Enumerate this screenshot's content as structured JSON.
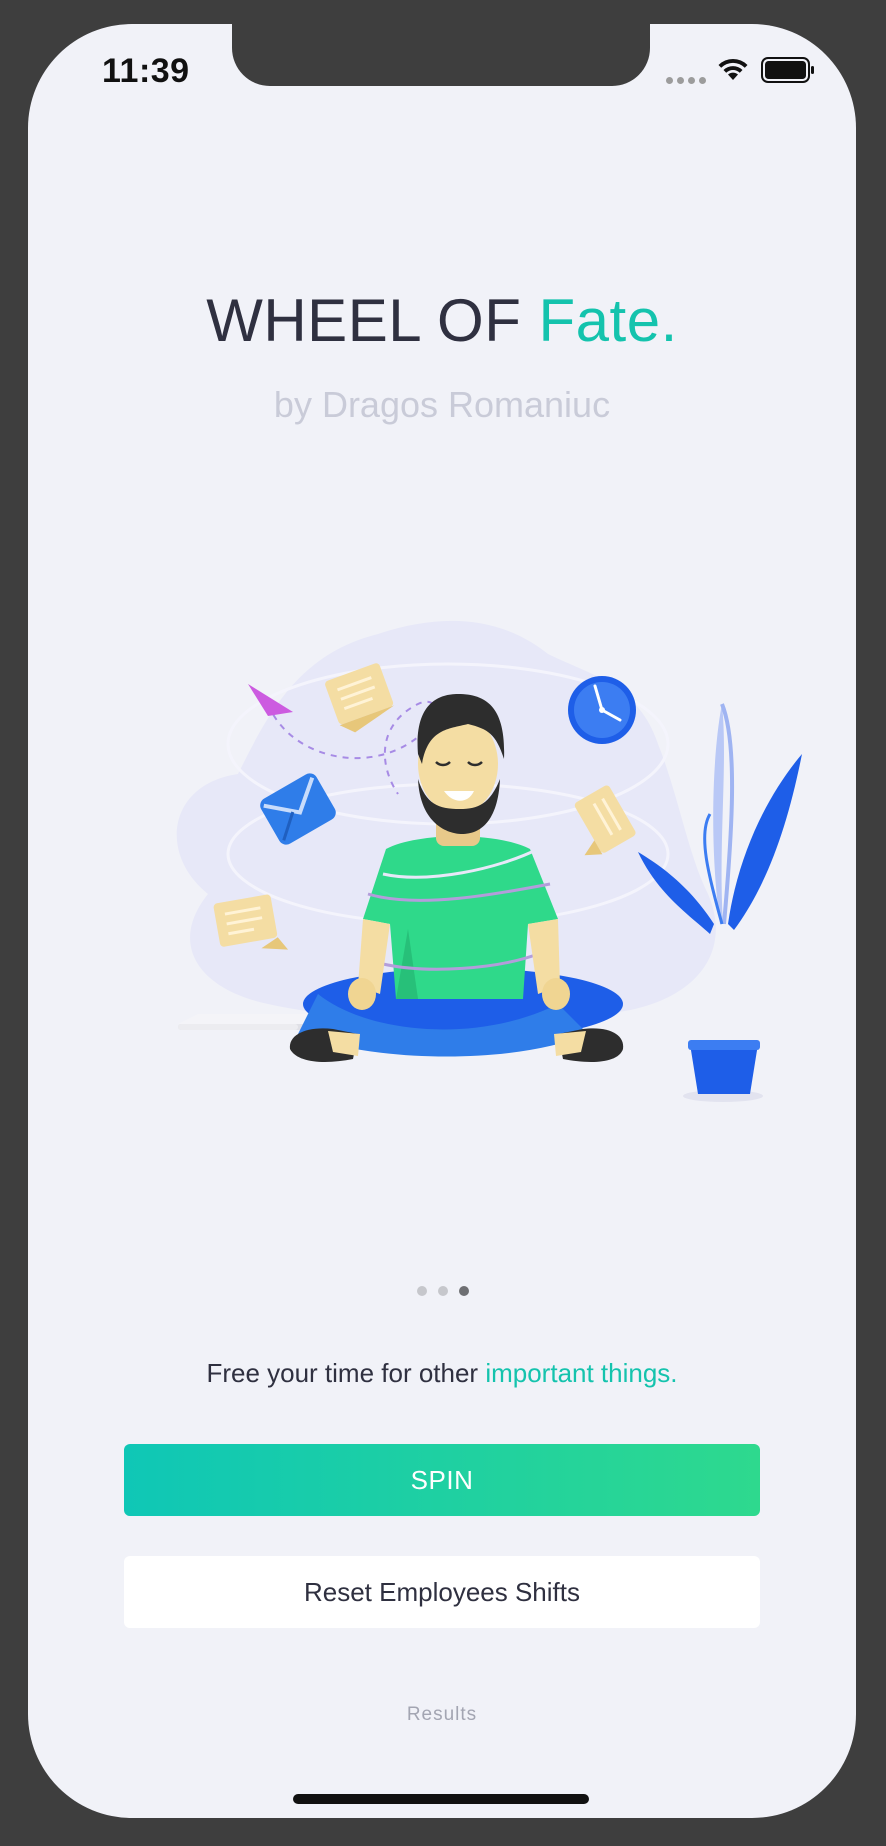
{
  "status_bar": {
    "time": "11:39"
  },
  "header": {
    "title_main": "WHEEL OF",
    "title_accent": "Fate.",
    "subtitle": "by Dragos Romaniuc"
  },
  "pager": {
    "page_count": 3,
    "current_page": 3
  },
  "tagline": {
    "text": "Free your time for other",
    "accent": "important things."
  },
  "actions": {
    "spin_label": "SPIN",
    "reset_label": "Reset Employees Shifts",
    "results_label": "Results"
  },
  "colors": {
    "accent": "#14c3ad",
    "spin_gradient_start": "#0fc7b6",
    "spin_gradient_end": "#2ed98e",
    "background": "#f1f2f8",
    "text_dark": "#2f3040"
  },
  "icons": [
    "cellular-signal-icon",
    "wifi-icon",
    "battery-icon"
  ]
}
